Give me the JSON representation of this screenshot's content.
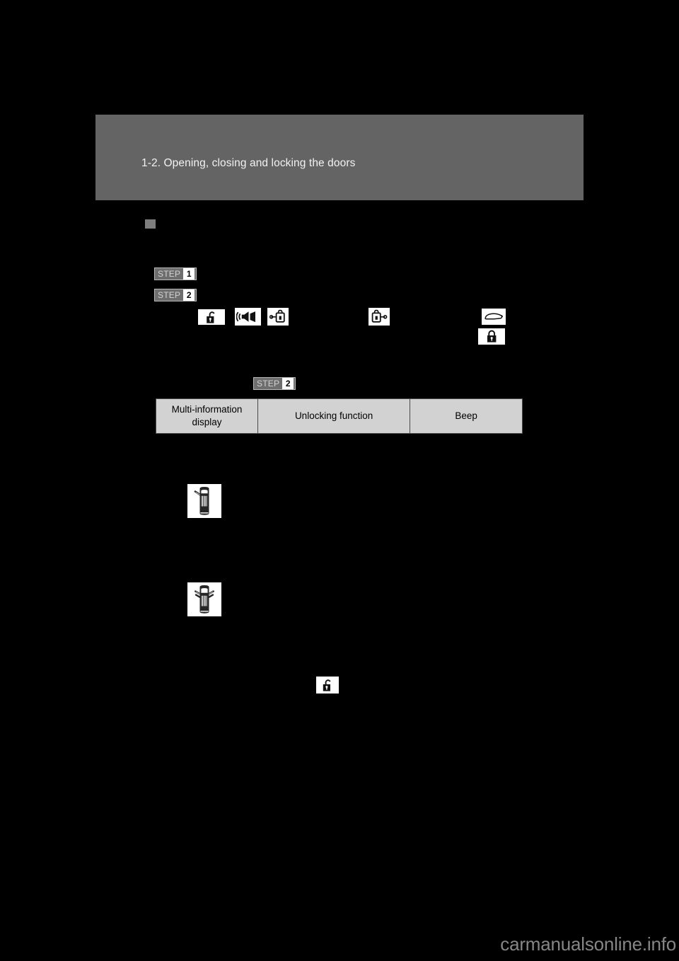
{
  "page": {
    "background_color": "#000000",
    "header_band_color": "#646464",
    "watermark": "carmanualsonline.info"
  },
  "header": {
    "title": "1-2. Opening, closing and locking the doors"
  },
  "section": {
    "bullet_color": "#7d7d7d"
  },
  "steps": [
    {
      "word": "STEP",
      "number": "1"
    },
    {
      "word": "STEP",
      "number": "2"
    },
    {
      "word": "STEP",
      "number": "2"
    }
  ],
  "icons": {
    "unlock_a": "padlock-open-icon",
    "speaker": "speaker-sound-icon",
    "lock_key": "lock-with-key-icon",
    "key_unlock": "key-unlock-icon",
    "car_side": "car-side-outline-icon",
    "lock_b": "padlock-closed-icon",
    "unlock_c": "padlock-open-icon"
  },
  "figures": [
    {
      "name": "car-top-view-driver-door",
      "caption": ""
    },
    {
      "name": "car-top-view-all-doors",
      "caption": ""
    }
  ],
  "table": {
    "headers": [
      "Multi-information display",
      "Unlocking function",
      "Beep"
    ],
    "header_bg": "#d2d2d2",
    "border_color": "#4a4a4a"
  }
}
